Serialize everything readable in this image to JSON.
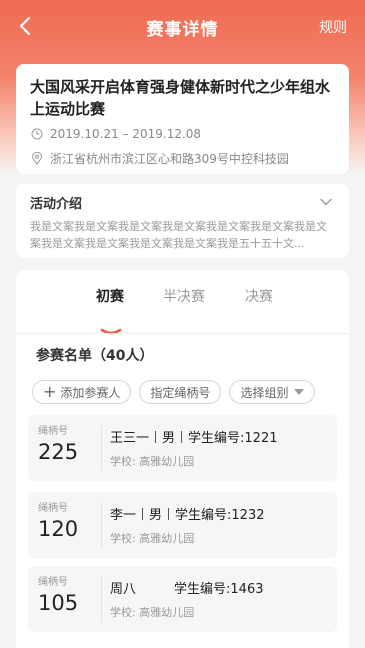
{
  "navbar": {
    "title": "赛事详情",
    "rule_label": "规则",
    "back_icon": "chevron-left-icon"
  },
  "event": {
    "title": "大国风采开启体育强身健体新时代之少年组水上运动比赛",
    "date_range": "2019.10.21 – 2019.12.08",
    "address": "浙江省杭州市滨江区心和路309号中控科技园"
  },
  "intro": {
    "title": "活动介绍",
    "text": "我是文案我是文案我是文案我是文案我是文案我是文案我是文案我是文案我是文案我是文案我是文案我是五十五十文..."
  },
  "tabs": [
    {
      "label": "初赛",
      "active": true
    },
    {
      "label": "半决赛",
      "active": false
    },
    {
      "label": "决赛",
      "active": false
    }
  ],
  "roster": {
    "title": "参赛名单（40人）",
    "add_label": "添加参赛人",
    "assign_label": "指定绳柄号",
    "group_label": "选择组别"
  },
  "players": [
    {
      "bib_label": "绳柄号",
      "bib": "225",
      "name": "王三一",
      "gender": "男",
      "student_no": "学生编号:1221",
      "school": "学校: 高雅幼儿园"
    },
    {
      "bib_label": "绳柄号",
      "bib": "120",
      "name": "李一",
      "gender": "男",
      "student_no": "学生编号:1232",
      "school": "学校: 高雅幼儿园"
    },
    {
      "bib_label": "绳柄号",
      "bib": "105",
      "name": "周八",
      "gender": "",
      "student_no": "学生编号:1463",
      "school": "学校: 高雅幼儿园"
    }
  ],
  "colors": {
    "accent": "#f06a52",
    "indicator": "#f25a3c"
  }
}
